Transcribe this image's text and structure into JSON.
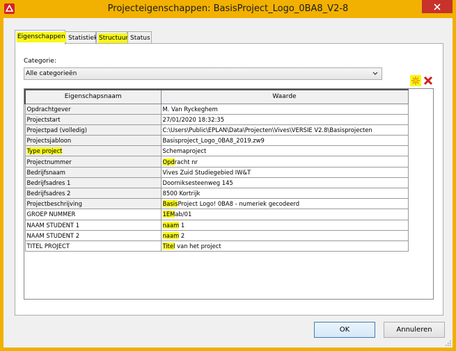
{
  "window": {
    "title": "Projecteigenschappen: BasisProject_Logo_0BA8_V2-8"
  },
  "tabs": [
    {
      "label": "Eigenschappen",
      "active": true,
      "highlighted": true
    },
    {
      "label": "Statistiek",
      "active": false,
      "highlighted": false
    },
    {
      "label": "Structuur",
      "active": false,
      "highlighted": true
    },
    {
      "label": "Status",
      "active": false,
      "highlighted": false
    }
  ],
  "category": {
    "label": "Categorie:",
    "selected": "Alle categorieën"
  },
  "grid": {
    "headers": [
      "Eigenschapsnaam",
      "Waarde"
    ],
    "rows": [
      {
        "name": "Opdrachtgever",
        "hl_name": "",
        "name_rest": "Opdrachtgever",
        "hl_value": "",
        "value_rest": "M. Van Ryckeghem"
      },
      {
        "name": "Projectstart",
        "hl_name": "",
        "name_rest": "Projectstart",
        "hl_value": "",
        "value_rest": "27/01/2020 18:32:35"
      },
      {
        "name": "Projectpad (volledig)",
        "hl_name": "",
        "name_rest": "Projectpad (volledig)",
        "hl_value": "",
        "value_rest": "C:\\Users\\Public\\EPLAN\\Data\\Projecten\\Vives\\VERSIE V2.8\\Basisprojecten"
      },
      {
        "name": "Projectsjabloon",
        "hl_name": "",
        "name_rest": "Projectsjabloon",
        "hl_value": "",
        "value_rest": "Basisproject_Logo_0BA8_2019.zw9"
      },
      {
        "name": "Type project",
        "hl_name": "Type project",
        "name_rest": "",
        "hl_value": "",
        "value_rest": "Schemaproject"
      },
      {
        "name": "Projectnummer",
        "hl_name": "",
        "name_rest": "Projectnummer",
        "hl_value": "Opd",
        "value_rest": "racht nr"
      },
      {
        "name": "Bedrijfsnaam",
        "hl_name": "",
        "name_rest": "Bedrijfsnaam",
        "hl_value": "",
        "value_rest": "Vives Zuid Studiegebied IW&T"
      },
      {
        "name": "Bedrijfsadres 1",
        "hl_name": "",
        "name_rest": "Bedrijfsadres 1",
        "hl_value": "",
        "value_rest": "Doorniksesteenweg 145"
      },
      {
        "name": "Bedrijfsadres 2",
        "hl_name": "",
        "name_rest": "Bedrijfsadres 2",
        "hl_value": "",
        "value_rest": "8500 Kortrijk"
      },
      {
        "name": "Projectbeschrijving",
        "hl_name": "",
        "name_rest": "Projectbeschrijving",
        "hl_value": "Basis",
        "value_rest": "Project Logo! 0BA8 - numeriek gecodeerd"
      },
      {
        "name": "GROEP NUMMER",
        "hl_name": "",
        "name_rest": "GROEP NUMMER",
        "hl_value": "1EM",
        "value_rest": "ab/01"
      },
      {
        "name": "NAAM STUDENT 1",
        "hl_name": "",
        "name_rest": "NAAM STUDENT 1",
        "hl_value": "naam",
        "value_rest": " 1"
      },
      {
        "name": "NAAM STUDENT 2",
        "hl_name": "",
        "name_rest": "NAAM STUDENT 2",
        "hl_value": "naam",
        "value_rest": " 2"
      },
      {
        "name": "TITEL PROJECT",
        "hl_name": "",
        "name_rest": "TITEL PROJECT",
        "hl_value": "Titel",
        "value_rest": " van het project"
      }
    ]
  },
  "buttons": {
    "ok": "OK",
    "cancel": "Annuleren"
  },
  "colors": {
    "titlebar": "#f2b100",
    "highlight": "#f7f71a",
    "close": "#c7322b"
  }
}
